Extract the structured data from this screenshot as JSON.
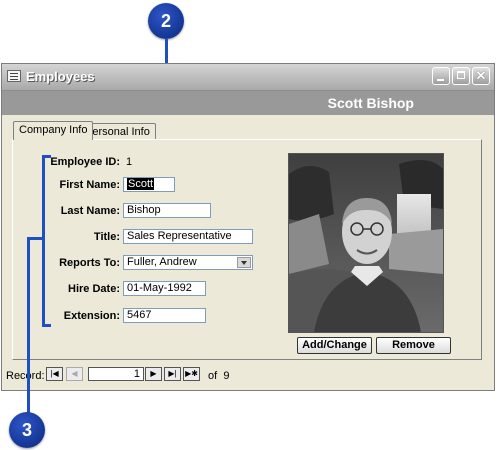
{
  "window": {
    "title": "Employees",
    "header_name": "Scott Bishop"
  },
  "tabs": [
    {
      "label": "Company Info"
    },
    {
      "label": "Personal Info"
    }
  ],
  "fields": {
    "employee_id": {
      "label": "Employee ID:",
      "value": "1"
    },
    "first_name": {
      "label": "First Name:",
      "value": "Scott"
    },
    "last_name": {
      "label": "Last Name:",
      "value": "Bishop"
    },
    "title": {
      "label": "Title:",
      "value": "Sales Representative"
    },
    "reports_to": {
      "label": "Reports To:",
      "value": "Fuller, Andrew"
    },
    "hire_date": {
      "label": "Hire Date:",
      "value": "01-May-1992"
    },
    "extension": {
      "label": "Extension:",
      "value": "5467"
    }
  },
  "photo_buttons": {
    "add_change": "Add/Change",
    "remove": "Remove"
  },
  "record_nav": {
    "label": "Record:",
    "current": "1",
    "of_text": "of",
    "total": "9"
  },
  "callouts": {
    "first": "2",
    "second": "3"
  },
  "colors": {
    "callout_blue": "#1f4fc4",
    "titlebar": "#a9a9a9",
    "header_band": "#999999",
    "form_bg": "#ece9d8"
  },
  "icons": {
    "window": "form-icon",
    "minimize": "minimize-icon",
    "maximize": "maximize-icon",
    "close": "close-icon",
    "dropdown": "chevron-down-icon"
  }
}
